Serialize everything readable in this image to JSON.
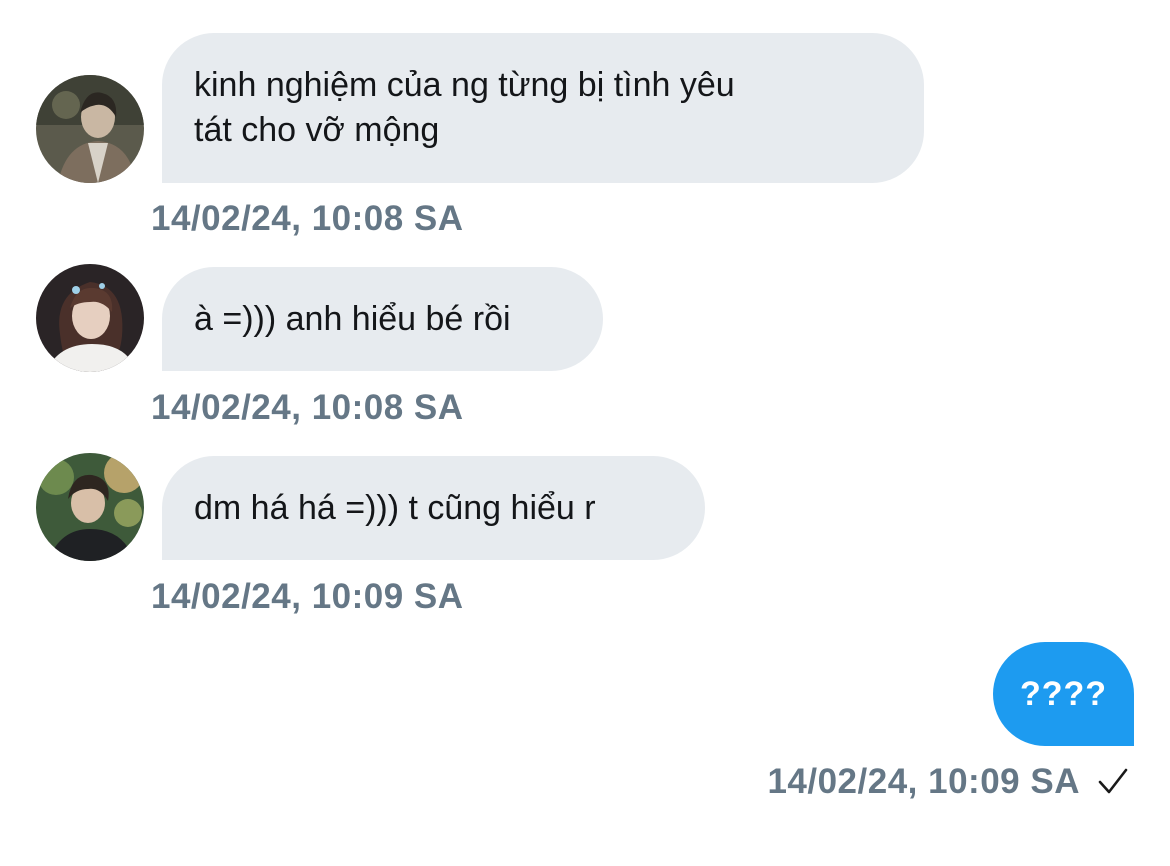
{
  "messages": [
    {
      "sender": "incoming",
      "avatar_icon": "avatar-photo-1",
      "text": "kinh nghiệm của ng từng bị tình yêu\ntát cho vỡ mộng",
      "timestamp": "14/02/24, 10:08 SA"
    },
    {
      "sender": "incoming",
      "avatar_icon": "avatar-photo-2",
      "text": "à =))) anh hiểu bé rồi",
      "timestamp": "14/02/24, 10:08 SA"
    },
    {
      "sender": "incoming",
      "avatar_icon": "avatar-photo-3",
      "text": "dm há há =))) t cũng hiểu r",
      "timestamp": "14/02/24, 10:09 SA"
    },
    {
      "sender": "outgoing",
      "text": "????",
      "timestamp": "14/02/24, 10:09 SA",
      "status_icon": "checkmark-icon"
    }
  ],
  "colors": {
    "incoming_bubble": "#e7ebef",
    "outgoing_bubble": "#1d9bf0",
    "timestamp": "#657786",
    "text": "#141619"
  }
}
